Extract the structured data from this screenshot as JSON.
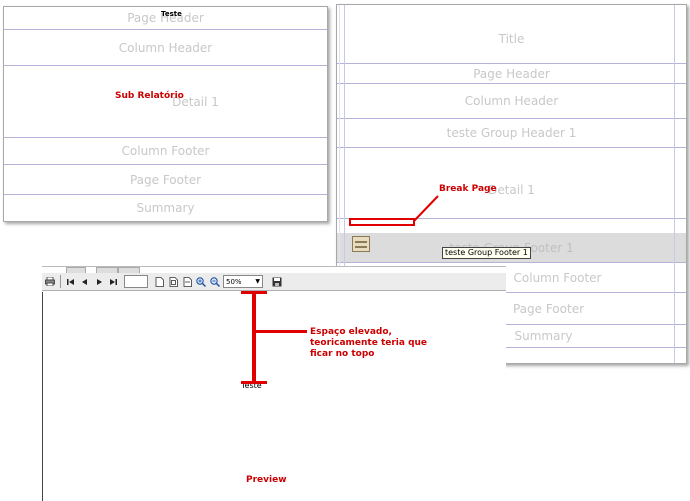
{
  "left_designer": {
    "bands": [
      {
        "label": "Page Header"
      },
      {
        "label": "Column Header"
      },
      {
        "label": "Detail 1"
      },
      {
        "label": "Column Footer"
      },
      {
        "label": "Page Footer"
      },
      {
        "label": "Summary"
      }
    ],
    "field_label": "Teste",
    "subreport_label": "Sub Relatório"
  },
  "right_designer": {
    "bands": [
      {
        "label": "Title"
      },
      {
        "label": "Page Header"
      },
      {
        "label": "Column Header"
      },
      {
        "label": "teste Group Header 1"
      },
      {
        "label": "Detail 1"
      },
      {
        "label": "teste Group Footer 1"
      },
      {
        "label": "Column Footer"
      },
      {
        "label": "Page Footer"
      },
      {
        "label": "Summary"
      }
    ],
    "tooltip": "teste Group Footer 1"
  },
  "annotations": {
    "break_page": "Break Page",
    "espaco_line1": "Espaço elevado,",
    "espaco_line2": "teoricamente teria que",
    "espaco_line3": "ficar no topo",
    "preview": "Preview"
  },
  "preview": {
    "zoom_value": "50%",
    "page_text": "Teste"
  },
  "colors": {
    "annotation": "#cc0000",
    "band_divider": "#b4b4d8",
    "band_label": "#c8c8c8"
  }
}
